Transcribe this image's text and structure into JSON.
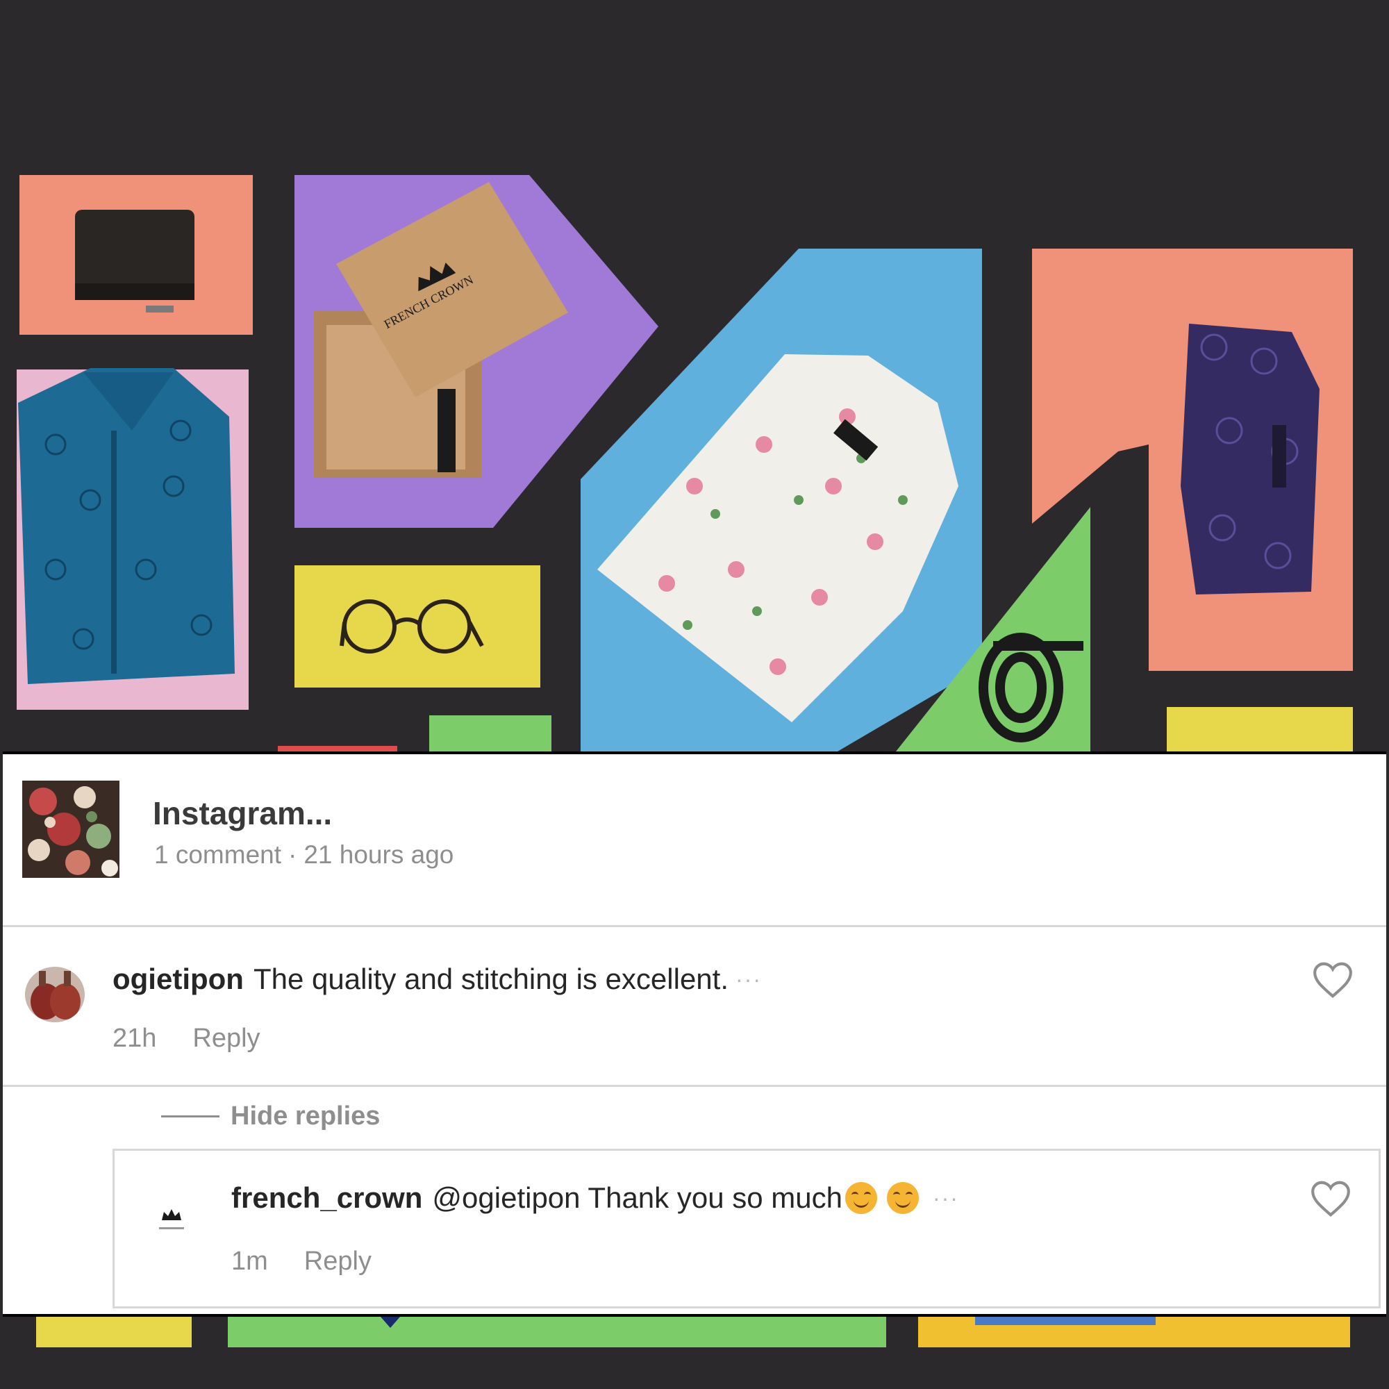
{
  "post": {
    "title": "Instagram...",
    "comment_count": "1 comment",
    "separator": "·",
    "time_ago": "21 hours ago"
  },
  "comment": {
    "username": "ogietipon",
    "text": "The quality and stitching is excellent.",
    "more": "···",
    "time": "21h",
    "reply_label": "Reply"
  },
  "hide_replies_label": "Hide replies",
  "reply": {
    "username": "french_crown",
    "text": "@ogietipon Thank you so much",
    "more": "···",
    "time": "1m",
    "reply_label": "Reply"
  },
  "brand": {
    "box_logo": "FRENCH CROWN"
  },
  "colors": {
    "background": "#2b292c",
    "panel": "#ffffff",
    "muted_text": "#8e8e8e",
    "text": "#262626",
    "salmon": "#f0927a",
    "purple": "#a07ad6",
    "sky_blue": "#5fb0dc",
    "pink": "#e9b8d0",
    "yellow": "#e6d84a",
    "green": "#7dcc6a"
  },
  "icons": [
    "heart-icon",
    "crown-icon",
    "smiling-emoji-icon"
  ]
}
